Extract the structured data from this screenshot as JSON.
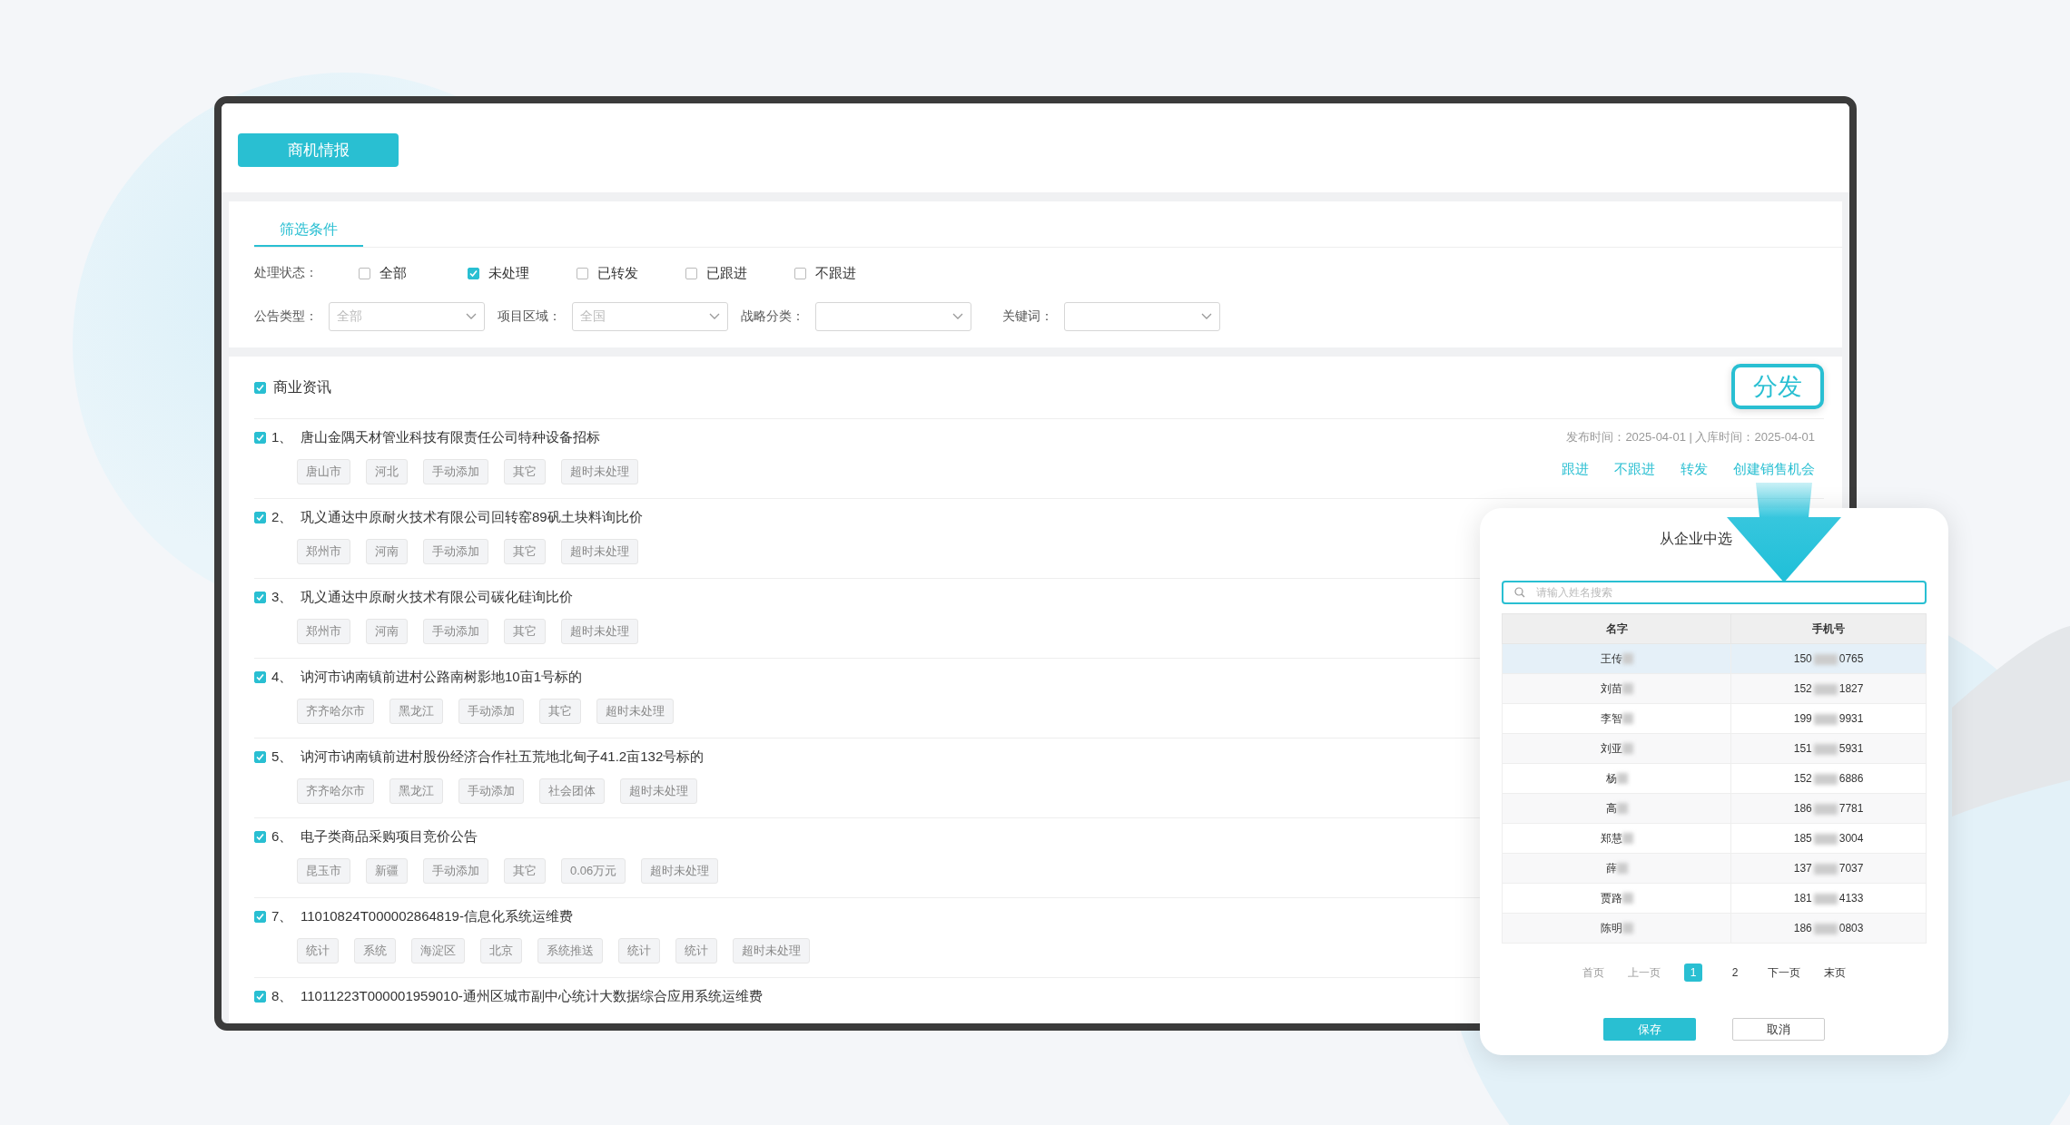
{
  "header_button": "商机情报",
  "filter_tab": "筛选条件",
  "status_filter": {
    "label": "处理状态：",
    "options": [
      {
        "label": "全部",
        "checked": false
      },
      {
        "label": "未处理",
        "checked": true
      },
      {
        "label": "已转发",
        "checked": false
      },
      {
        "label": "已跟进",
        "checked": false
      },
      {
        "label": "不跟进",
        "checked": false
      }
    ]
  },
  "dropdowns": [
    {
      "label": "公告类型：",
      "placeholder": "全部"
    },
    {
      "label": "项目区域：",
      "placeholder": "全国"
    },
    {
      "label": "战略分类："
    },
    {
      "label": "关键词："
    }
  ],
  "section": {
    "label": "商业资讯",
    "checked": true
  },
  "distribute_button": "分发",
  "items": [
    {
      "index": "1、",
      "title": "唐山金隅天材管业科技有限责任公司特种设备招标",
      "checked": true,
      "tags": [
        "唐山市",
        "河北",
        "手动添加",
        "其它",
        "超时未处理"
      ],
      "meta": "发布时间：2025-04-01 | 入库时间：2025-04-01",
      "actions": [
        "跟进",
        "不跟进",
        "转发",
        "创建销售机会"
      ]
    },
    {
      "index": "2、",
      "title": "巩义通达中原耐火技术有限公司回转窑89矾土块料询比价",
      "checked": true,
      "tags": [
        "郑州市",
        "河南",
        "手动添加",
        "其它",
        "超时未处理"
      ]
    },
    {
      "index": "3、",
      "title": "巩义通达中原耐火技术有限公司碳化硅询比价",
      "checked": true,
      "tags": [
        "郑州市",
        "河南",
        "手动添加",
        "其它",
        "超时未处理"
      ]
    },
    {
      "index": "4、",
      "title": "讷河市讷南镇前进村公路南树影地10亩1号标的",
      "checked": true,
      "tags": [
        "齐齐哈尔市",
        "黑龙江",
        "手动添加",
        "其它",
        "超时未处理"
      ]
    },
    {
      "index": "5、",
      "title": "讷河市讷南镇前进村股份经济合作社五荒地北甸子41.2亩132号标的",
      "checked": true,
      "tags": [
        "齐齐哈尔市",
        "黑龙江",
        "手动添加",
        "社会团体",
        "超时未处理"
      ]
    },
    {
      "index": "6、",
      "title": "电子类商品采购项目竞价公告",
      "checked": true,
      "tags": [
        "昆玉市",
        "新疆",
        "手动添加",
        "其它",
        "0.06万元",
        "超时未处理"
      ]
    },
    {
      "index": "7、",
      "title": "11010824T000002864819-信息化系统运维费",
      "checked": true,
      "tags": [
        "统计",
        "系统",
        "海淀区",
        "北京",
        "系统推送",
        "统计",
        "统计",
        "超时未处理"
      ]
    },
    {
      "index": "8、",
      "title": "11011223T000001959010-通州区城市副中心统计大数据综合应用系统运维费",
      "checked": true
    }
  ],
  "dialog": {
    "title": "从企业中选",
    "search": {
      "placeholder": "请输入姓名搜索"
    },
    "columns": [
      "名字",
      "手机号"
    ],
    "rows": [
      {
        "name": "王传",
        "phone_start": "150",
        "phone_end": "0765",
        "selected": true
      },
      {
        "name": "刘苗",
        "phone_start": "152",
        "phone_end": "1827",
        "selected": false
      },
      {
        "name": "李智",
        "phone_start": "199",
        "phone_end": "9931",
        "selected": false
      },
      {
        "name": "刘亚",
        "phone_start": "151",
        "phone_end": "5931",
        "selected": false
      },
      {
        "name": "杨",
        "phone_start": "152",
        "phone_end": "6886",
        "selected": false
      },
      {
        "name": "高",
        "phone_start": "186",
        "phone_end": "7781",
        "selected": false
      },
      {
        "name": "郑慧",
        "phone_start": "185",
        "phone_end": "3004",
        "selected": false
      },
      {
        "name": "薛",
        "phone_start": "137",
        "phone_end": "7037",
        "selected": false
      },
      {
        "name": "贾路",
        "phone_start": "181",
        "phone_end": "4133",
        "selected": false
      },
      {
        "name": "陈明",
        "phone_start": "186",
        "phone_end": "0803",
        "selected": false
      }
    ],
    "pagination": [
      {
        "label": "首页",
        "kind": "nav",
        "disabled": true
      },
      {
        "label": "上一页",
        "kind": "nav",
        "disabled": true
      },
      {
        "label": "1",
        "kind": "page",
        "selected": true
      },
      {
        "label": "2",
        "kind": "page",
        "selected": false
      },
      {
        "label": "下一页",
        "kind": "nav",
        "disabled": false
      },
      {
        "label": "末页",
        "kind": "nav",
        "disabled": false
      }
    ],
    "buttons": [
      {
        "label": "保存",
        "kind": "primary"
      },
      {
        "label": "取消",
        "kind": "secondary"
      }
    ]
  }
}
